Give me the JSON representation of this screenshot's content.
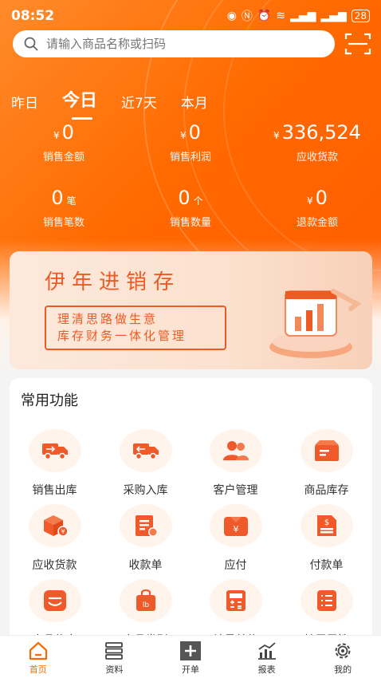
{
  "statusbar": {
    "time": "08:52",
    "battery": "28"
  },
  "search": {
    "placeholder": "请输入商品名称或扫码"
  },
  "tabs": [
    {
      "label": "昨日",
      "active": false
    },
    {
      "label": "今日",
      "active": true
    },
    {
      "label": "近7天",
      "active": false
    },
    {
      "label": "本月",
      "active": false
    }
  ],
  "stats": {
    "sales_amount": {
      "currency": "¥",
      "value": "0",
      "label": "销售金额"
    },
    "sales_profit": {
      "currency": "¥",
      "value": "0",
      "label": "销售利润"
    },
    "receivable": {
      "currency": "¥",
      "value": "336,524",
      "label": "应收货款"
    },
    "sales_count": {
      "value": "0",
      "unit": "笔",
      "label": "销售笔数"
    },
    "sales_qty": {
      "value": "0",
      "unit": "个",
      "label": "销售数量"
    },
    "refund": {
      "currency": "¥",
      "value": "0",
      "label": "退款金额"
    }
  },
  "banner": {
    "title": "伊年进销存",
    "line1": "理清思路做生意",
    "line2": "库存财务一体化管理"
  },
  "functions": {
    "title": "常用功能",
    "items": [
      {
        "label": "销售出库",
        "icon": "truck-out-icon"
      },
      {
        "label": "采购入库",
        "icon": "truck-in-icon"
      },
      {
        "label": "客户管理",
        "icon": "users-icon"
      },
      {
        "label": "商品库存",
        "icon": "box-icon"
      },
      {
        "label": "应收货款",
        "icon": "parcel-icon"
      },
      {
        "label": "收款单",
        "icon": "receipt-icon"
      },
      {
        "label": "应付",
        "icon": "payable-icon"
      },
      {
        "label": "付款单",
        "icon": "payment-doc-icon"
      },
      {
        "label": "商品信息",
        "icon": "tray-icon"
      },
      {
        "label": "商品类别",
        "icon": "bag-icon"
      },
      {
        "label": "计量单位",
        "icon": "calculator-icon"
      },
      {
        "label": "扩展属性",
        "icon": "list-icon"
      }
    ]
  },
  "nav": [
    {
      "label": "首页",
      "active": true,
      "icon": "home-icon"
    },
    {
      "label": "资料",
      "active": false,
      "icon": "database-icon"
    },
    {
      "label": "开单",
      "active": false,
      "icon": "plus-icon"
    },
    {
      "label": "报表",
      "active": false,
      "icon": "chart-icon"
    },
    {
      "label": "我的",
      "active": false,
      "icon": "gear-icon"
    }
  ],
  "colors": {
    "primary": "#ff6a00",
    "accent": "#ee5a24"
  }
}
